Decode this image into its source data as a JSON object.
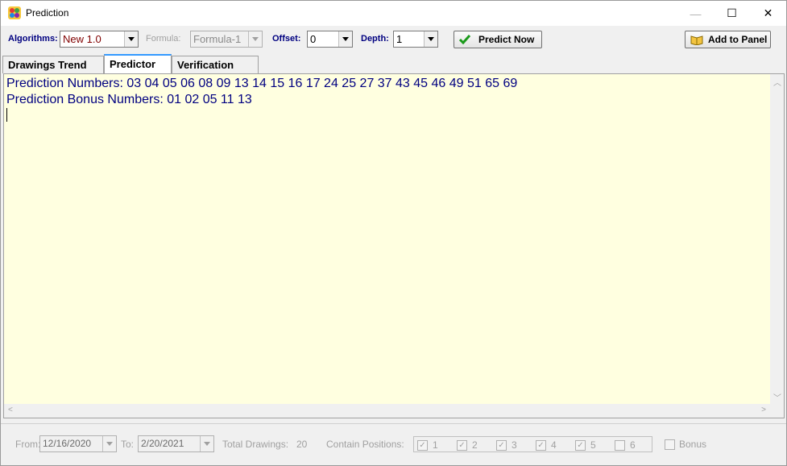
{
  "window": {
    "title": "Prediction",
    "icon": "app-palette-icon",
    "controls": {
      "minimize": "—",
      "maximize": "☐",
      "close": "✕"
    }
  },
  "toolbar": {
    "algorithms_label": "Algorithms:",
    "algorithms_value": "New 1.0",
    "formula_label": "Formula:",
    "formula_value": "Formula-1",
    "offset_label": "Offset:",
    "offset_value": "0",
    "depth_label": "Depth:",
    "depth_value": "1",
    "predict_button": "Predict Now",
    "predict_icon": "checkmark-icon",
    "add_panel_button": "Add to Panel",
    "add_panel_icon": "book-icon"
  },
  "tabs": [
    {
      "label": "Drawings Trend",
      "active": false
    },
    {
      "label": "Predictor",
      "active": true
    },
    {
      "label": "Verification",
      "active": false
    }
  ],
  "editor": {
    "lines": [
      "Prediction Numbers: 03 04 05 06 08 09 13 14 15 16 17 24 25 27 37 43 45 46 49 51 65 69",
      "Prediction Bonus Numbers: 01 02 05 11 13"
    ]
  },
  "bottom": {
    "from_label": "From:",
    "from_value": "12/16/2020",
    "to_label": "To:",
    "to_value": "2/20/2021",
    "total_label": "Total Drawings:",
    "total_value": "20",
    "contain_label": "Contain Positions:",
    "positions": [
      {
        "label": "1",
        "checked": true
      },
      {
        "label": "2",
        "checked": true
      },
      {
        "label": "3",
        "checked": true
      },
      {
        "label": "4",
        "checked": true
      },
      {
        "label": "5",
        "checked": true
      },
      {
        "label": "6",
        "checked": false
      }
    ],
    "bonus_label": "Bonus",
    "bonus_checked": false
  },
  "colors": {
    "editor_bg": "#ffffe0",
    "text_navy": "#000080",
    "active_tab_accent": "#3399ff",
    "algorithm_value": "#800000"
  }
}
